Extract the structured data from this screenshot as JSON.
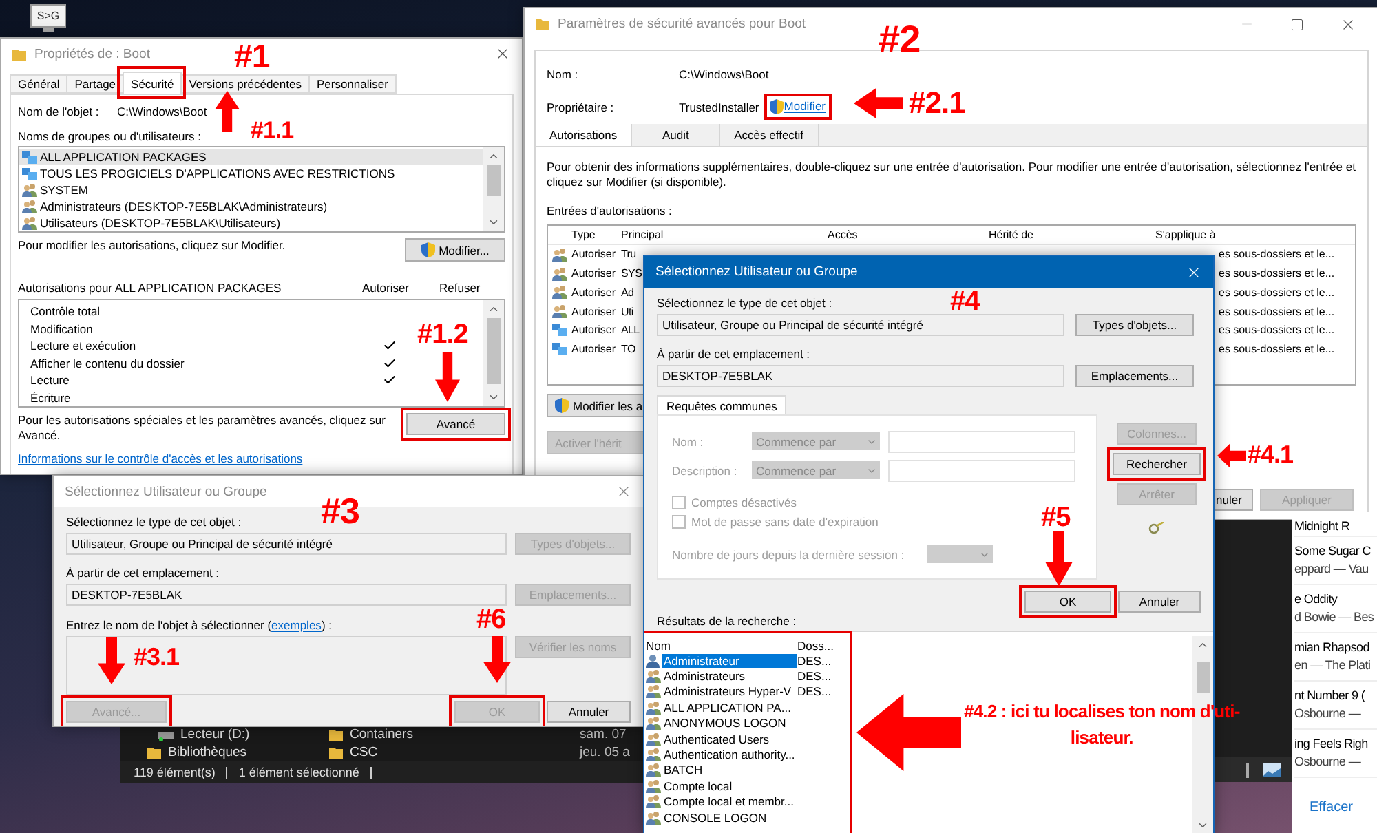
{
  "desktop_icon": {
    "label": "S>G"
  },
  "properties_window": {
    "title": "Propriétés de : Boot",
    "tabs": [
      {
        "label": "Général",
        "selected": false,
        "highlighted": false
      },
      {
        "label": "Partage",
        "selected": false,
        "highlighted": false
      },
      {
        "label": "Sécurité",
        "selected": true,
        "highlighted": true
      },
      {
        "label": "Versions précédentes",
        "selected": false,
        "highlighted": false
      },
      {
        "label": "Personnaliser",
        "selected": false,
        "highlighted": false
      }
    ],
    "object_label": "Nom de l'objet :",
    "object_value": "C:\\Windows\\Boot",
    "groups_label": "Noms de groupes ou d'utilisateurs :",
    "groups": [
      {
        "kind": "package",
        "name": "ALL APPLICATION PACKAGES",
        "selected": true
      },
      {
        "kind": "package",
        "name": "TOUS LES PROGICIELS D'APPLICATIONS AVEC RESTRICTIONS",
        "selected": false
      },
      {
        "kind": "group",
        "name": "SYSTEM",
        "selected": false
      },
      {
        "kind": "group",
        "name": "Administrateurs (DESKTOP-7E5BLAK\\Administrateurs)",
        "selected": false
      },
      {
        "kind": "group",
        "name": "Utilisateurs (DESKTOP-7E5BLAK\\Utilisateurs)",
        "selected": false
      }
    ],
    "modify_hint": "Pour modifier les autorisations, cliquez sur Modifier.",
    "modify_button": "Modifier...",
    "permissions_label": "Autorisations pour ALL APPLICATION PACKAGES",
    "columns": [
      "Autoriser",
      "Refuser"
    ],
    "permissions": [
      {
        "name": "Contrôle total",
        "allow": false,
        "deny": false
      },
      {
        "name": "Modification",
        "allow": false,
        "deny": false
      },
      {
        "name": "Lecture et exécution",
        "allow": true,
        "deny": false
      },
      {
        "name": "Afficher le contenu du dossier",
        "allow": true,
        "deny": false
      },
      {
        "name": "Lecture",
        "allow": true,
        "deny": false
      },
      {
        "name": "Écriture",
        "allow": false,
        "deny": false
      }
    ],
    "advanced_hint": "Pour les autorisations spéciales et les paramètres avancés, cliquez sur Avancé.",
    "advanced_button": {
      "label": "Avancé",
      "highlighted": true
    },
    "info_link": "Informations sur le contrôle d'accès et les autorisations"
  },
  "advanced_window": {
    "title": "Paramètres de sécurité avancés pour Boot",
    "name_label": "Nom :",
    "name_value": "C:\\Windows\\Boot",
    "owner_label": "Propriétaire :",
    "owner_value": "TrustedInstaller",
    "owner_link": {
      "label": "Modifier",
      "highlighted": true
    },
    "tabs": [
      {
        "label": "Autorisations",
        "selected": true
      },
      {
        "label": "Audit",
        "selected": false
      },
      {
        "label": "Accès effectif",
        "selected": false
      }
    ],
    "description": "Pour obtenir des informations supplémentaires, double-cliquez sur une entrée d'autorisation. Pour modifier une entrée d'autorisation, sélectionnez l'entrée et cliquez sur Modifier (si disponible).",
    "entries_label": "Entrées d'autorisations :",
    "columns": [
      "Type",
      "Principal",
      "Accès",
      "Hérité de",
      "S'applique à"
    ],
    "rows": [
      {
        "kind": "group",
        "type": "Autoriser",
        "principal": "Tru",
        "applies_to": "es sous-dossiers et le..."
      },
      {
        "kind": "group",
        "type": "Autoriser",
        "principal": "SYS",
        "applies_to": "es sous-dossiers et le..."
      },
      {
        "kind": "group",
        "type": "Autoriser",
        "principal": "Ad",
        "applies_to": "es sous-dossiers et le..."
      },
      {
        "kind": "group",
        "type": "Autoriser",
        "principal": "Uti",
        "applies_to": "es sous-dossiers et le..."
      },
      {
        "kind": "package",
        "type": "Autoriser",
        "principal": "ALL",
        "applies_to": "es sous-dossiers et le..."
      },
      {
        "kind": "package",
        "type": "Autoriser",
        "principal": "TO",
        "applies_to": "es sous-dossiers et le..."
      }
    ],
    "buttons": [
      {
        "label": "Modifier les a",
        "shield": true,
        "disabled": false
      },
      {
        "label": "Activer l'hérit",
        "shield": false,
        "disabled": true
      }
    ],
    "footer_buttons": [
      {
        "label": "nuler",
        "disabled": false
      },
      {
        "label": "Appliquer",
        "disabled": true
      }
    ]
  },
  "media_panel": {
    "tracks": [
      {
        "title": "Midnight R"
      },
      {
        "title": "Some Sugar C",
        "subtitle": "eppard — Vau"
      },
      {
        "title": "e Oddity",
        "subtitle": "d Bowie — Bes"
      },
      {
        "title": "mian Rhapsod",
        "subtitle": "en — The Plati"
      },
      {
        "title": "nt Number 9 (",
        "subtitle": "Osbourne —"
      },
      {
        "title": "ing Feels Righ",
        "subtitle": "Osbourne —"
      }
    ],
    "clear": "Effacer"
  },
  "explorer": {
    "nav": [
      {
        "kind": "drive",
        "label": "Lecteur (D:)"
      },
      {
        "kind": "library",
        "label": "Bibliothèques"
      }
    ],
    "files": [
      {
        "name": "Containers",
        "date": "sam. 07"
      },
      {
        "name": "CSC",
        "date": "jeu. 05 a"
      }
    ],
    "status": [
      "119 élément(s)",
      "1 élément sélectionné"
    ]
  },
  "select_dialog_back": {
    "title": "Sélectionnez Utilisateur ou Groupe",
    "active": false,
    "type_label": "Sélectionnez le type de cet objet :",
    "type_value": "Utilisateur, Groupe ou Principal de sécurité intégré",
    "type_button": {
      "label": "Types d'objets...",
      "disabled": true
    },
    "location_label": "À partir de cet emplacement :",
    "location_value": "DESKTOP-7E5BLAK",
    "location_button": {
      "label": "Emplacements...",
      "disabled": true
    },
    "enter_label": {
      "before": "Entrez le nom de l'objet à sélectionner (",
      "link": "exemples",
      "after": ") :"
    },
    "check_button": {
      "label": "Vérifier les noms",
      "disabled": true
    },
    "advanced_button": {
      "label": "Avancé...",
      "disabled": true,
      "highlighted": true
    },
    "ok_button": {
      "label": "OK",
      "disabled": true,
      "highlighted": true
    },
    "cancel_button": {
      "label": "Annuler",
      "disabled": false,
      "highlighted": false
    }
  },
  "select_dialog_front": {
    "title": "Sélectionnez Utilisateur ou Groupe",
    "active": true,
    "type_label": "Sélectionnez le type de cet objet :",
    "type_value": "Utilisateur, Groupe ou Principal de sécurité intégré",
    "type_button": {
      "label": "Types d'objets...",
      "disabled": false
    },
    "location_label": "À partir de cet emplacement :",
    "location_value": "DESKTOP-7E5BLAK",
    "location_button": {
      "label": "Emplacements...",
      "disabled": false
    },
    "query_tab": "Requêtes communes",
    "query_rows": [
      {
        "label": "Nom :",
        "operator": "Commence par",
        "disabled": true
      },
      {
        "label": "Description :",
        "operator": "Commence par",
        "disabled": true
      }
    ],
    "checkboxes": [
      {
        "label": "Comptes désactivés",
        "checked": false,
        "disabled": true
      },
      {
        "label": "Mot de passe sans date d'expiration",
        "checked": false,
        "disabled": true
      }
    ],
    "days_label": "Nombre de jours depuis la dernière session :",
    "side_buttons": [
      {
        "label": "Colonnes...",
        "disabled": true,
        "highlighted": false
      },
      {
        "label": "Rechercher",
        "disabled": false,
        "highlighted": true
      },
      {
        "label": "Arrêter",
        "disabled": true,
        "highlighted": false
      }
    ],
    "ok_button": {
      "label": "OK",
      "disabled": false,
      "highlighted": true
    },
    "cancel_button": {
      "label": "Annuler",
      "disabled": false,
      "highlighted": false
    },
    "results_label": "Résultats de la recherche :",
    "results": {
      "highlighted": true,
      "columns": [
        "Nom",
        "Doss..."
      ],
      "rows": [
        {
          "kind": "user",
          "name": "Administrateur",
          "folder": "DES...",
          "selected": true
        },
        {
          "kind": "group",
          "name": "Administrateurs",
          "folder": "DES...",
          "selected": false
        },
        {
          "kind": "group",
          "name": "Administrateurs Hyper-V",
          "folder": "DES...",
          "selected": false
        },
        {
          "kind": "group",
          "name": "ALL APPLICATION PA...",
          "selected": false
        },
        {
          "kind": "group",
          "name": "ANONYMOUS LOGON",
          "selected": false
        },
        {
          "kind": "group",
          "name": "Authenticated Users",
          "selected": false
        },
        {
          "kind": "group",
          "name": "Authentication authority...",
          "selected": false
        },
        {
          "kind": "group",
          "name": "BATCH",
          "selected": false
        },
        {
          "kind": "group",
          "name": "Compte local",
          "selected": false
        },
        {
          "kind": "group",
          "name": "Compte local et membr...",
          "selected": false
        },
        {
          "kind": "group",
          "name": "CONSOLE LOGON",
          "selected": false
        }
      ]
    }
  },
  "annotations": [
    {
      "label": "#1"
    },
    {
      "label": "#1.1"
    },
    {
      "label": "#1.2"
    },
    {
      "label": "#2"
    },
    {
      "label": "#2.1"
    },
    {
      "label": "#3"
    },
    {
      "label": "#3.1"
    },
    {
      "label": "#6"
    },
    {
      "label": "#4"
    },
    {
      "label": "#4.1"
    },
    {
      "label": "#5"
    }
  ],
  "note": "#4.2 : ici tu localises ton nom d'uti-\nlisateur."
}
